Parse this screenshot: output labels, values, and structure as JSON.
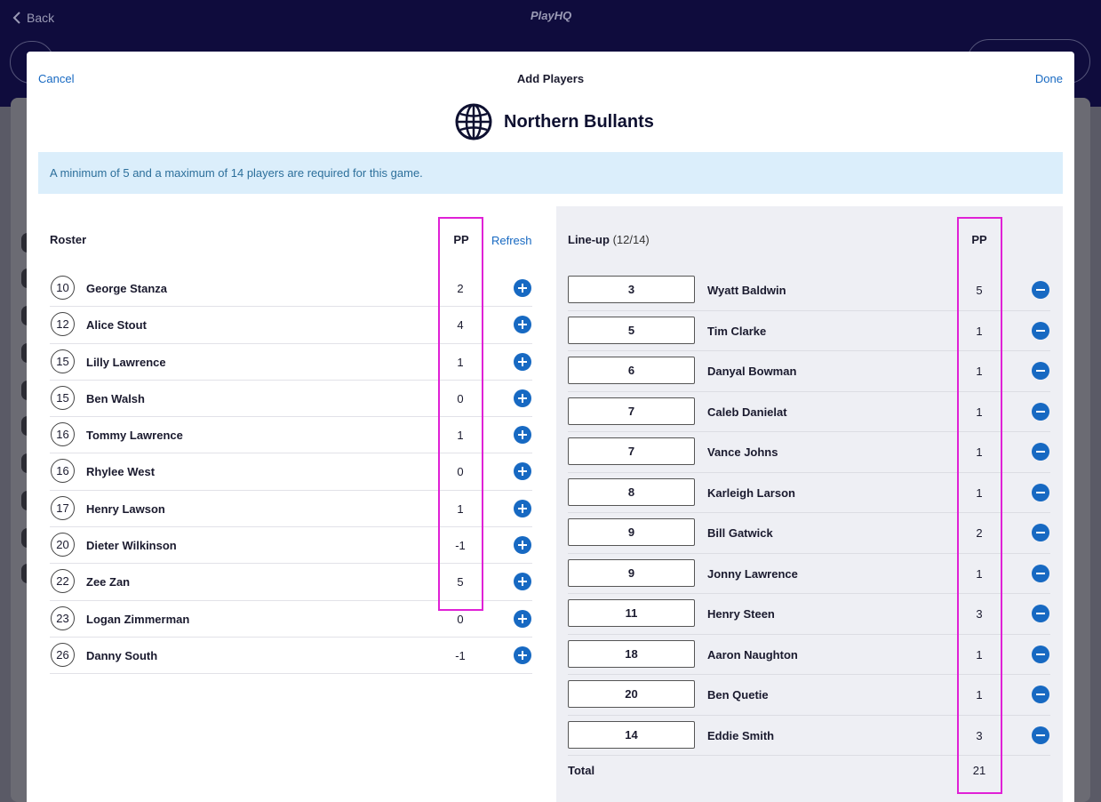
{
  "background": {
    "back_label": "Back",
    "logo_text": "PlayHQ"
  },
  "modal": {
    "cancel_label": "Cancel",
    "title": "Add Players",
    "done_label": "Done",
    "team_name": "Northern Bullants",
    "team_icon": "globe-icon",
    "info_text": "A minimum of 5 and a maximum of 14 players are required for this game."
  },
  "roster": {
    "title": "Roster",
    "pp_header": "PP",
    "refresh_label": "Refresh",
    "add_icon": "plus-circle-icon",
    "players": [
      {
        "number": "10",
        "name": "George Stanza",
        "pp": "2"
      },
      {
        "number": "12",
        "name": "Alice Stout",
        "pp": "4"
      },
      {
        "number": "15",
        "name": "Lilly Lawrence",
        "pp": "1"
      },
      {
        "number": "15",
        "name": "Ben Walsh",
        "pp": "0"
      },
      {
        "number": "16",
        "name": "Tommy Lawrence",
        "pp": "1"
      },
      {
        "number": "16",
        "name": "Rhylee West",
        "pp": "0"
      },
      {
        "number": "17",
        "name": "Henry Lawson",
        "pp": "1"
      },
      {
        "number": "20",
        "name": "Dieter Wilkinson",
        "pp": "-1"
      },
      {
        "number": "22",
        "name": "Zee Zan",
        "pp": "5"
      },
      {
        "number": "23",
        "name": "Logan Zimmerman",
        "pp": "0"
      },
      {
        "number": "26",
        "name": "Danny South",
        "pp": "-1"
      }
    ]
  },
  "lineup": {
    "title": "Line-up",
    "count": "(12/14)",
    "pp_header": "PP",
    "remove_icon": "minus-circle-icon",
    "players": [
      {
        "number": "3",
        "name": "Wyatt Baldwin",
        "pp": "5"
      },
      {
        "number": "5",
        "name": "Tim Clarke",
        "pp": "1"
      },
      {
        "number": "6",
        "name": "Danyal Bowman",
        "pp": "1"
      },
      {
        "number": "7",
        "name": "Caleb Danielat",
        "pp": "1"
      },
      {
        "number": "7",
        "name": "Vance Johns",
        "pp": "1"
      },
      {
        "number": "8",
        "name": "Karleigh Larson",
        "pp": "1"
      },
      {
        "number": "9",
        "name": "Bill Gatwick",
        "pp": "2"
      },
      {
        "number": "9",
        "name": "Jonny Lawrence",
        "pp": "1"
      },
      {
        "number": "11",
        "name": "Henry Steen",
        "pp": "3"
      },
      {
        "number": "18",
        "name": "Aaron Naughton",
        "pp": "1"
      },
      {
        "number": "20",
        "name": "Ben Quetie",
        "pp": "1"
      },
      {
        "number": "14",
        "name": "Eddie Smith",
        "pp": "3"
      }
    ],
    "total_label": "Total",
    "total_value": "21"
  },
  "colors": {
    "accent": "#1769c2",
    "header_bg": "#0f0c3d",
    "info_bg": "#dbeefb",
    "highlight": "#e021d6"
  }
}
